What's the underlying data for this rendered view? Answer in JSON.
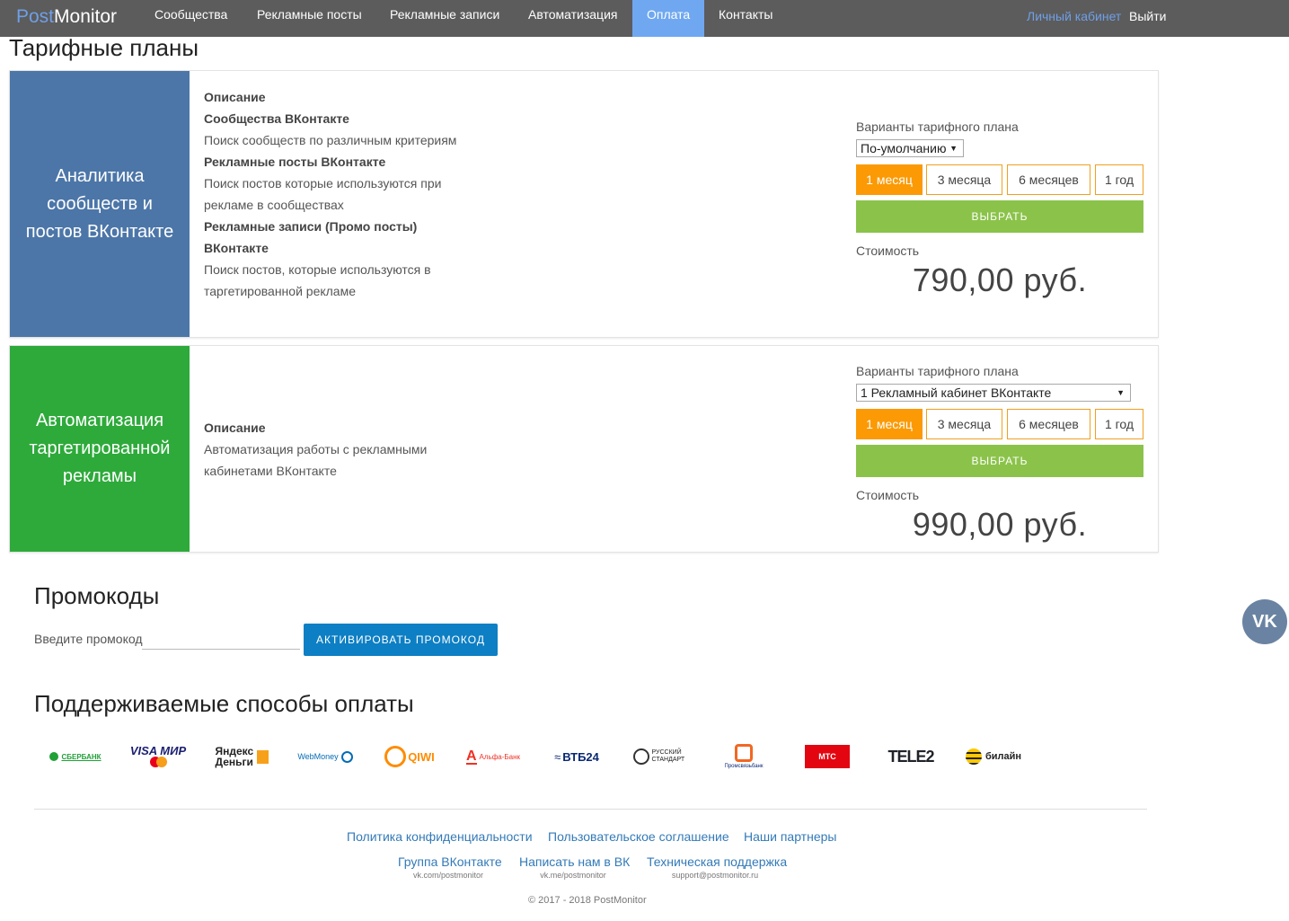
{
  "nav": {
    "brand_part1": "Post",
    "brand_part2": "Monitor",
    "items": [
      "Сообщества",
      "Рекламные посты",
      "Рекламные записи",
      "Автоматизация",
      "Оплата",
      "Контакты"
    ],
    "active": "Оплата",
    "cabinet": "Личный кабинет",
    "logout": "Выйти"
  },
  "page_title": "Тарифные планы",
  "plans": [
    {
      "name": "Аналитика сообществ и постов ВКонтакте",
      "desc_heading": "Описание",
      "desc": [
        {
          "type": "h",
          "text": "Сообщества ВКонтакте"
        },
        {
          "type": "p",
          "text": "Поиск сообществ по различным критериям"
        },
        {
          "type": "h",
          "text": "Рекламные посты ВКонтакте"
        },
        {
          "type": "p",
          "text": "Поиск постов которые используются при рекламе в сообществах"
        },
        {
          "type": "h",
          "text": "Рекламные записи (Промо посты) ВКонтакте"
        },
        {
          "type": "p",
          "text": "Поиск постов, которые используются в таргетированной рекламе"
        }
      ],
      "options_label": "Варианты тарифного плана",
      "select_value": "По-умолчанию",
      "periods": [
        "1 месяц",
        "3 месяца",
        "6 месяцев",
        "1 год"
      ],
      "selected_period": "1 месяц",
      "choose_label": "ВЫБРАТЬ",
      "cost_label": "Стоимость",
      "price": "790,00 руб."
    },
    {
      "name": "Автоматизация таргетированной рекламы",
      "desc_heading": "Описание",
      "desc": [
        {
          "type": "p",
          "text": "Автоматизация работы с рекламными кабинетами ВКонтакте"
        }
      ],
      "options_label": "Варианты тарифного плана",
      "select_value": "1 Рекламный кабинет ВКонтакте",
      "periods": [
        "1 месяц",
        "3 месяца",
        "6 месяцев",
        "1 год"
      ],
      "selected_period": "1 месяц",
      "choose_label": "ВЫБРАТЬ",
      "cost_label": "Стоимость",
      "price": "990,00 руб."
    }
  ],
  "promo": {
    "title": "Промокоды",
    "label": "Введите промокод",
    "value": "",
    "button": "АКТИВИРОВАТЬ ПРОМОКОД"
  },
  "payments": {
    "title": "Поддерживаемые способы оплаты",
    "logos": [
      {
        "name": "sberbank-logo",
        "text": "СБЕРБАНК",
        "color": "#21a038"
      },
      {
        "name": "visa-mir-mastercard-logo",
        "text": "VISA МИР",
        "color": "#1a1f71"
      },
      {
        "name": "yandex-money-logo",
        "text": "Яндекс Деньги",
        "color": "#222222"
      },
      {
        "name": "webmoney-logo",
        "text": "WebMoney",
        "color": "#036cb5"
      },
      {
        "name": "qiwi-logo",
        "text": "QIWI",
        "color": "#ff8c00"
      },
      {
        "name": "alfa-bank-logo",
        "text": "Альфа-Банк",
        "color": "#ef3124"
      },
      {
        "name": "vtb24-logo",
        "text": "ВТБ24",
        "color": "#0a2973"
      },
      {
        "name": "russian-standard-logo",
        "text": "РУССКИЙ СТАНДАРТ",
        "color": "#222222"
      },
      {
        "name": "promsvyazbank-logo",
        "text": "Промсвязьбанк",
        "color": "#f26722"
      },
      {
        "name": "mts-logo",
        "text": "МТС",
        "color": "#e30611"
      },
      {
        "name": "tele2-logo",
        "text": "TELE2",
        "color": "#1f2229"
      },
      {
        "name": "beeline-logo",
        "text": "билайн",
        "color": "#ffc800"
      }
    ]
  },
  "footer": {
    "links_row1": [
      "Политика конфиденциальности",
      "Пользовательское соглашение",
      "Наши партнеры"
    ],
    "links_row2": [
      {
        "label": "Группа ВКонтакте",
        "sub": "vk.com/postmonitor"
      },
      {
        "label": "Написать нам в ВК",
        "sub": "vk.me/postmonitor"
      },
      {
        "label": "Техническая поддержка",
        "sub": "support@postmonitor.ru"
      }
    ],
    "copyright": "© 2017 - 2018 PostMonitor"
  },
  "vk_button": "VK"
}
